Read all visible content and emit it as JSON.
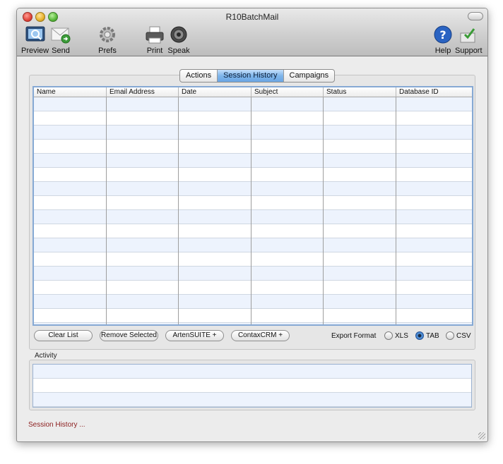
{
  "window": {
    "title": "R10BatchMail"
  },
  "toolbar": {
    "preview": "Preview",
    "send": "Send",
    "prefs": "Prefs",
    "print": "Print",
    "speak": "Speak",
    "help": "Help",
    "support": "Support"
  },
  "tabs": [
    {
      "label": "Actions",
      "active": false
    },
    {
      "label": "Session History",
      "active": true
    },
    {
      "label": "Campaigns",
      "active": false
    }
  ],
  "table": {
    "columns": [
      "Name",
      "Email Address",
      "Date",
      "Subject",
      "Status",
      "Database ID"
    ],
    "rows": []
  },
  "buttons": {
    "clear_list": "Clear List",
    "remove_selected": "Remove Selected",
    "artensuite": "ArtenSUITE +",
    "contaxcrm": "ContaxCRM +"
  },
  "export": {
    "label": "Export Format",
    "options": [
      "XLS",
      "TAB",
      "CSV"
    ],
    "selected": "TAB"
  },
  "activity": {
    "label": "Activity",
    "items": []
  },
  "status": {
    "text": "Session History ..."
  },
  "colors": {
    "accent": "#6aa6e4",
    "status_text": "#8b1c1c"
  }
}
